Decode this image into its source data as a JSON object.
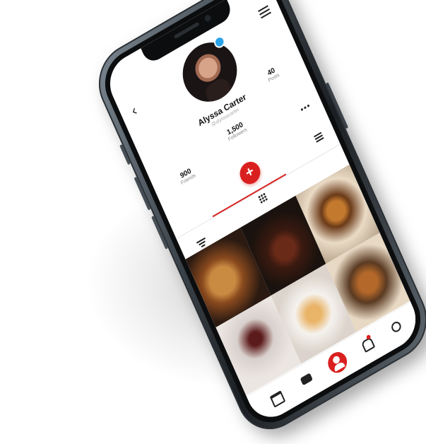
{
  "profile": {
    "name": "Alyssa Carter",
    "handle": "@alyssacarter"
  },
  "stats": {
    "posts": {
      "value": "40",
      "label": "Posts"
    },
    "followers": {
      "value": "1,500",
      "label": "Followers"
    },
    "friends": {
      "value": "900",
      "label": "Friends"
    }
  },
  "icons": {
    "back": "chevron-left-icon",
    "menu": "hamburger-icon",
    "more": "more-dots-icon",
    "add": "plus-icon",
    "list_view": "list-view-icon",
    "grid_view": "grid-view-icon",
    "filter": "filter-icon",
    "search": "search-icon",
    "notifications": "bell-icon",
    "profile": "user-icon",
    "messages": "chat-icon",
    "home": "browser-window-icon"
  },
  "glyphs": {
    "back": "‹",
    "more": "•••",
    "add": "+"
  },
  "colors": {
    "accent": "#d9201f",
    "online_status": "#2aa3e8"
  }
}
